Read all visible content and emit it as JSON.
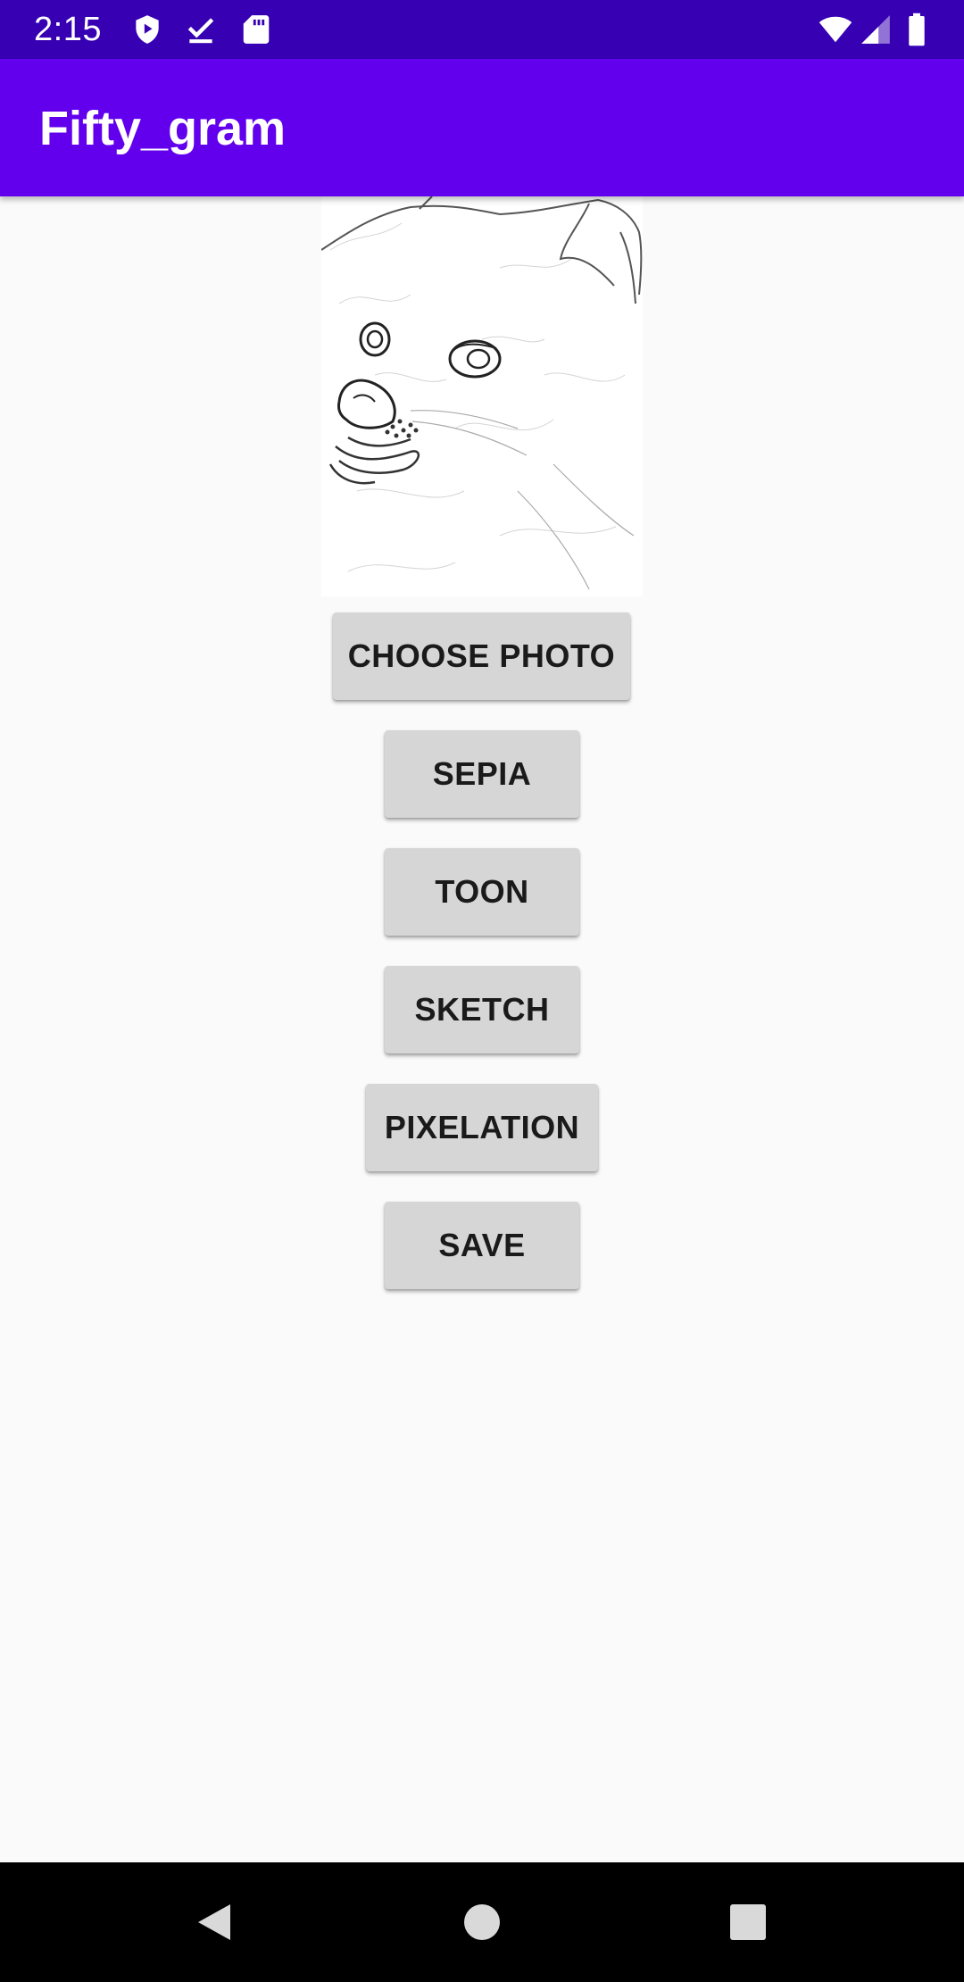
{
  "status_bar": {
    "time": "2:15",
    "icons_left": [
      "play-protect-icon",
      "download-done-icon",
      "sd-card-icon"
    ],
    "icons_right": [
      "wifi-icon",
      "cell-signal-icon",
      "battery-icon"
    ],
    "background": "#3700b3"
  },
  "app_bar": {
    "title": "Fifty_gram",
    "background": "#6200ee"
  },
  "photo": {
    "description_icon": "sketch-dog-image"
  },
  "buttons": {
    "choose_photo": "CHOOSE PHOTO",
    "sepia": "SEPIA",
    "toon": "TOON",
    "sketch": "SKETCH",
    "pixelation": "PIXELATION",
    "save": "SAVE"
  },
  "nav_bar": {
    "icons": [
      "back-icon",
      "home-icon",
      "recents-icon"
    ]
  }
}
